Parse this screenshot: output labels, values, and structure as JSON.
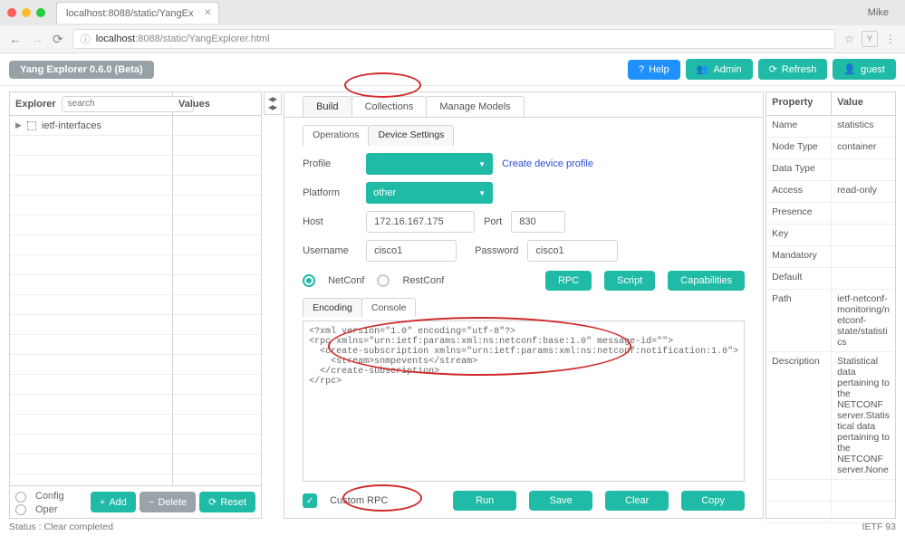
{
  "browser": {
    "tab_title": "localhost:8088/static/YangEx",
    "profile": "Mike",
    "url_prefix": "localhost",
    "url_port_path": ":8088/static/YangExplorer.html"
  },
  "header": {
    "brand": "Yang Explorer 0.6.0 (Beta)",
    "help": "Help",
    "admin": "Admin",
    "refresh": "Refresh",
    "guest": "guest"
  },
  "explorer": {
    "label": "Explorer",
    "search_placeholder": "search",
    "values_label": "Values",
    "tree_item": "ietf-interfaces",
    "config": "Config",
    "oper": "Oper",
    "add": "Add",
    "delete": "Delete",
    "reset": "Reset"
  },
  "center": {
    "tab_build": "Build",
    "tab_collections": "Collections",
    "tab_models": "Manage Models",
    "subtab_ops": "Operations",
    "subtab_dev": "Device Settings",
    "lbl_profile": "Profile",
    "create_profile": "Create device profile",
    "lbl_platform": "Platform",
    "platform_val": "other",
    "lbl_host": "Host",
    "host_val": "172.16.167.175",
    "lbl_port": "Port",
    "port_val": "830",
    "lbl_user": "Username",
    "user_val": "cisco1",
    "lbl_pass": "Password",
    "pass_val": "cisco1",
    "proto_netconf": "NetConf",
    "proto_restconf": "RestConf",
    "btn_rpc": "RPC",
    "btn_script": "Script",
    "btn_caps": "Capabilities",
    "enc_tab": "Encoding",
    "console_tab": "Console",
    "rpc_xml": "<?xml version=\"1.0\" encoding=\"utf-8\"?>\n<rpc xmlns=\"urn:ietf:params:xml:ns:netconf:base:1.0\" message-id=\"\">\n  <create-subscription xmlns=\"urn:ietf:params:xml:ns:netconf:notification:1.0\">\n    <stream>snmpevents</stream>\n  </create-subscription>\n</rpc>",
    "custom_rpc": "Custom RPC",
    "btn_run": "Run",
    "btn_save": "Save",
    "btn_clear": "Clear",
    "btn_copy": "Copy"
  },
  "props": {
    "h_prop": "Property",
    "h_val": "Value",
    "rows": {
      "name_k": "Name",
      "name_v": "statistics",
      "type_k": "Node Type",
      "type_v": "container",
      "dtype_k": "Data Type",
      "dtype_v": "",
      "access_k": "Access",
      "access_v": "read-only",
      "pres_k": "Presence",
      "pres_v": "",
      "key_k": "Key",
      "key_v": "",
      "mand_k": "Mandatory",
      "mand_v": "",
      "def_k": "Default",
      "def_v": "",
      "path_k": "Path",
      "path_v": "ietf-netconf-monitoring/netconf-state/statistics",
      "desc_k": "Description",
      "desc_v": "Statistical data pertaining to the NETCONF server.Statistical data pertaining to the NETCONF server.None"
    }
  },
  "status": {
    "text": "Status : Clear completed",
    "right": "IETF 93"
  }
}
